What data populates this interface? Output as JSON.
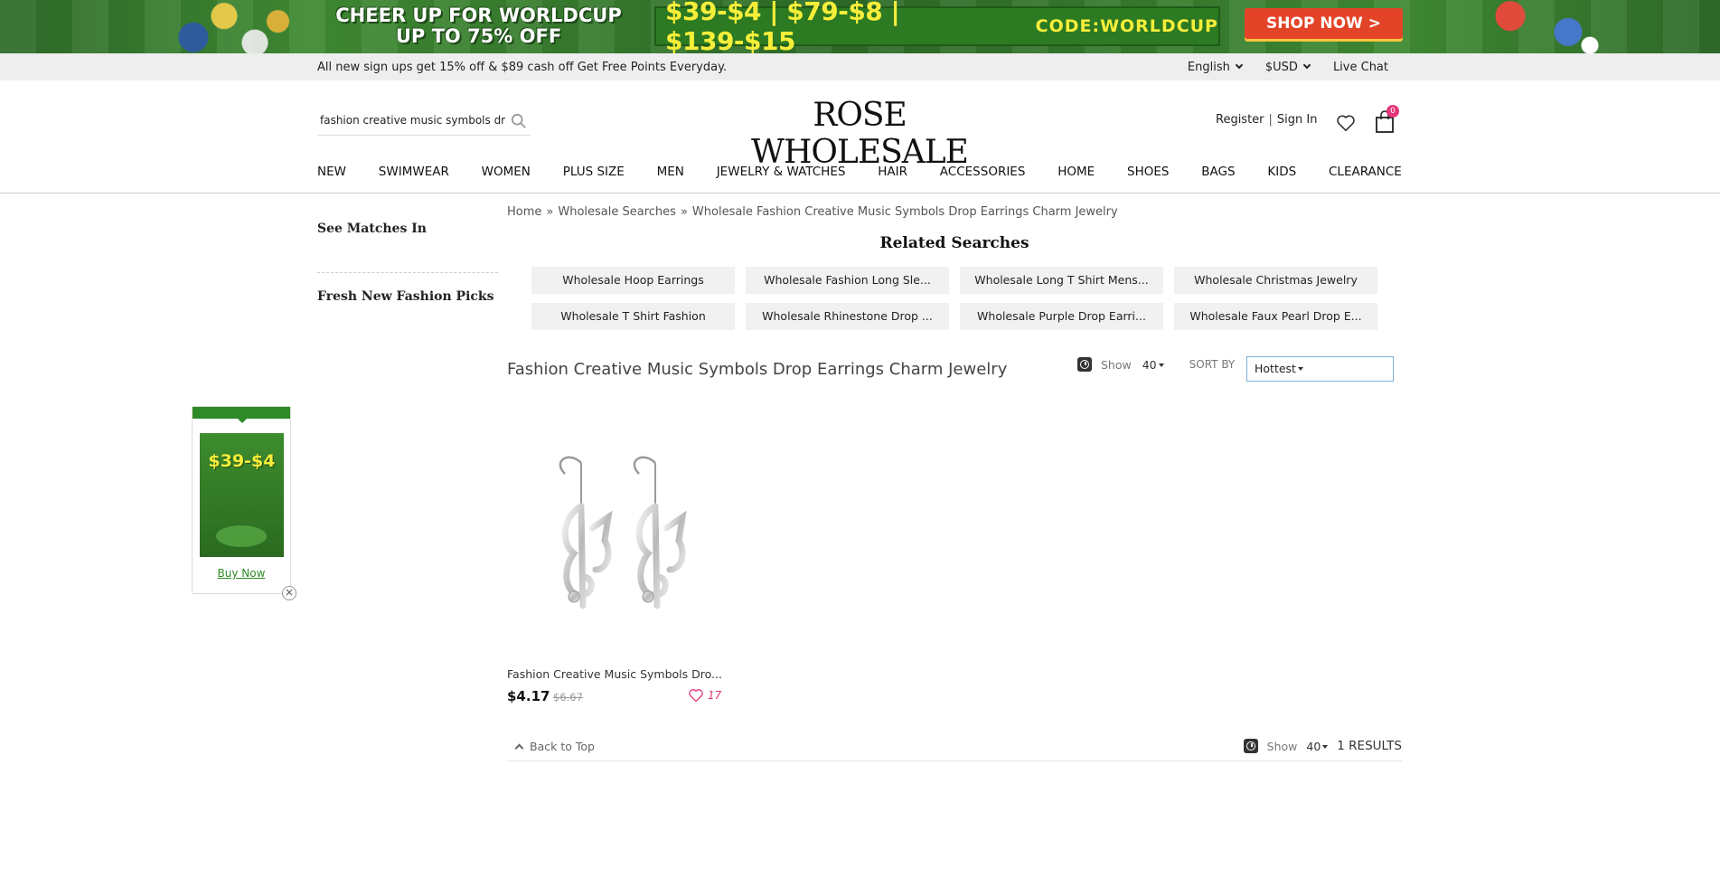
{
  "banner": {
    "cheer_line1": "CHEER UP FOR WORLDCUP",
    "cheer_line2": "UP TO 75% OFF",
    "deals": "$39-$4 | $79-$8 | $139-$15",
    "code": "CODE:WORLDCUP",
    "shop_now": "SHOP NOW  >"
  },
  "infostrip": {
    "promo": "All new sign ups get 15% off & $89 cash off  Get Free Points Everyday.",
    "language": "English",
    "currency": "$USD",
    "live_chat": "Live Chat"
  },
  "header": {
    "search_value": "fashion creative music symbols drop",
    "logo": "ROSE WHOLESALE",
    "register": "Register",
    "sign_in": "Sign In",
    "cart_count": "0"
  },
  "nav": [
    "NEW",
    "SWIMWEAR",
    "WOMEN",
    "PLUS SIZE",
    "MEN",
    "JEWELRY & WATCHES",
    "HAIR",
    "ACCESSORIES",
    "HOME",
    "SHOES",
    "BAGS",
    "KIDS",
    "CLEARANCE"
  ],
  "sidebar": {
    "see_matches": "See Matches In",
    "fresh_picks": "Fresh New Fashion Picks"
  },
  "floating": {
    "amount": "$39-$4",
    "buy_now": "Buy Now",
    "close": "×"
  },
  "breadcrumb": {
    "home": "Home",
    "searches": "Wholesale Searches",
    "current": "Wholesale Fashion Creative Music Symbols Drop Earrings Charm Jewelry",
    "sep": "»"
  },
  "related": {
    "title": "Related Searches",
    "items": [
      "Wholesale Hoop Earrings",
      "Wholesale Fashion Long Sle...",
      "Wholesale Long T Shirt Mens...",
      "Wholesale Christmas Jewelry",
      "Wholesale T Shirt Fashion",
      "Wholesale Rhinestone Drop ...",
      "Wholesale Purple Drop Earri...",
      "Wholesale Faux Pearl Drop E..."
    ]
  },
  "results": {
    "title": "Fashion Creative Music Symbols Drop Earrings Charm Jewelry",
    "show_label": "Show",
    "show_value": "40",
    "sort_label": "SORT BY",
    "sort_value": "Hottest",
    "count_text": "1 RESULTS"
  },
  "product": {
    "name": "Fashion Creative Music Symbols Dro...",
    "price": "$4.17",
    "old_price": "$6.67",
    "favorites": "17"
  },
  "footer_bar": {
    "back_to_top": "Back to Top"
  }
}
